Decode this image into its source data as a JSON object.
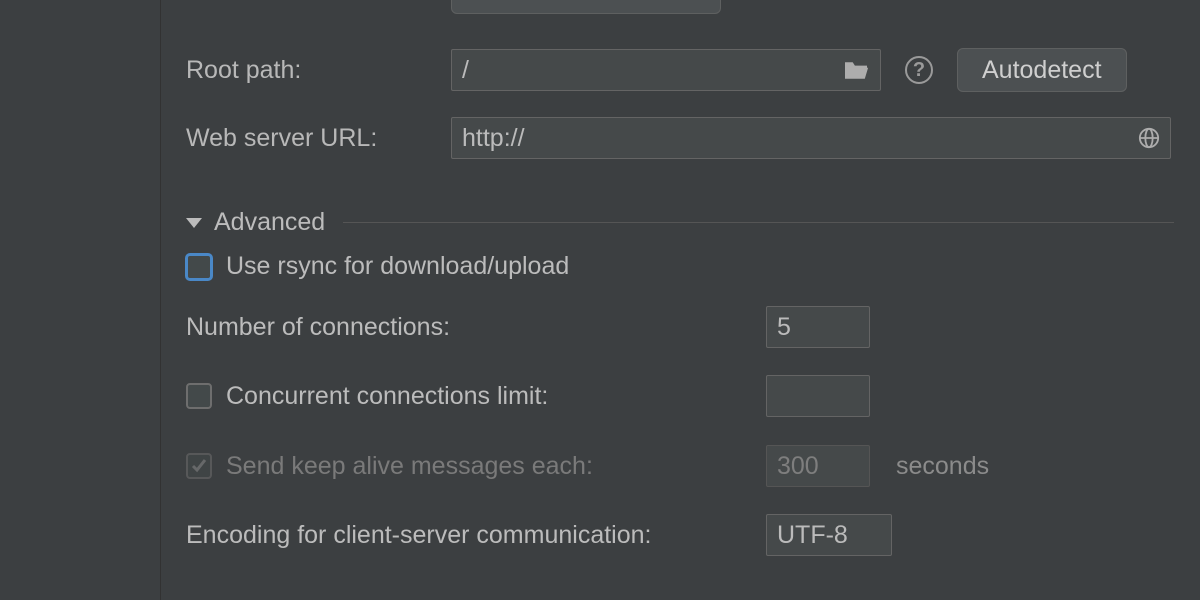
{
  "root_path": {
    "label": "Root path:",
    "value": "/",
    "autodetect_label": "Autodetect"
  },
  "web_server_url": {
    "label": "Web server URL:",
    "value": "http://"
  },
  "advanced": {
    "title": "Advanced",
    "rsync": {
      "label": "Use rsync for download/upload",
      "checked": false,
      "focused": true
    },
    "num_connections": {
      "label": "Number of connections:",
      "value": "5"
    },
    "concurrent_limit": {
      "label": "Concurrent connections limit:",
      "checked": false,
      "value": ""
    },
    "keep_alive": {
      "label": "Send keep alive messages each:",
      "checked": true,
      "enabled": false,
      "value": "300",
      "suffix": "seconds"
    },
    "encoding": {
      "label": "Encoding for client-server communication:",
      "value": "UTF-8"
    }
  }
}
